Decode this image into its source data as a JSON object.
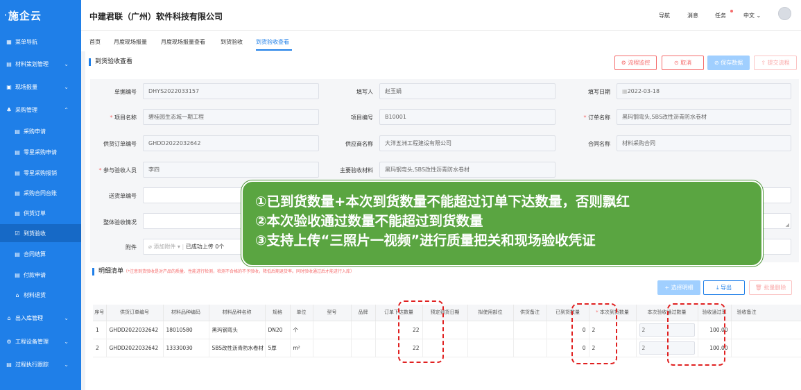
{
  "app": {
    "logo": "施企云"
  },
  "sidebar": {
    "items": [
      {
        "label": "菜单导航",
        "icon": "grid-icon"
      },
      {
        "label": "材料策划管理",
        "icon": "doc-icon"
      },
      {
        "label": "现场报量",
        "icon": "doc-icon"
      },
      {
        "label": "采购管理",
        "icon": "org-icon"
      },
      {
        "label": "采购申请",
        "icon": "doc-icon"
      },
      {
        "label": "零星采购申请",
        "icon": "doc-icon"
      },
      {
        "label": "零星采购报销",
        "icon": "doc-icon"
      },
      {
        "label": "采购合同台账",
        "icon": "doc-icon"
      },
      {
        "label": "供货订单",
        "icon": "doc-icon"
      },
      {
        "label": "到货验收",
        "icon": "check-icon"
      },
      {
        "label": "合同结算",
        "icon": "doc-icon"
      },
      {
        "label": "付款申请",
        "icon": "doc-icon"
      },
      {
        "label": "材料退货",
        "icon": "doc-icon"
      },
      {
        "label": "出入库管理",
        "icon": "home-icon"
      },
      {
        "label": "工程设备管理",
        "icon": "gear-icon"
      },
      {
        "label": "过程执行跟踪",
        "icon": "doc-icon"
      }
    ]
  },
  "header": {
    "company": "中建君联（广州）软件科技有限公司",
    "links": [
      "导航",
      "消息",
      "任务",
      "中文"
    ]
  },
  "tabs": [
    "首页",
    "月度现场报量",
    "月度现场报量查看",
    "到货验收",
    "到货验收查看"
  ],
  "page": {
    "title": "到货验收查看",
    "buttons": {
      "process": "流程监控",
      "cancel": "取消",
      "save": "保存数据",
      "submit": "提交流程"
    }
  },
  "form": {
    "doc_no_label": "单据编号",
    "doc_no": "DHYS2022033157",
    "filler_label": "填写人",
    "filler": "赵玉娟",
    "date_label": "填写日期",
    "date": "2022-03-18",
    "project_name_label": "项目名称",
    "project_name": "碧桂园生态城一期工程",
    "project_no_label": "项目编号",
    "project_no": "B10001",
    "order_name_label": "订单名称",
    "order_name": "黑玛钢弯头,SBS改性沥青防水卷材",
    "supply_order_label": "供货订单编号",
    "supply_order": "GHDD2022032642",
    "supplier_label": "供应商名称",
    "supplier": "大洋五洲工程建设有限公司",
    "contract_label": "合同名称",
    "contract": "材料采购合同",
    "inspector_label": "参与验收人员",
    "inspector": "李四",
    "material_label": "主要验收材料",
    "material": "黑玛钢弯头,SBS改性沥青防水卷材",
    "delivery_label": "送货单编号",
    "overall_label": "整体验收情况",
    "attach_label": "附件",
    "attach_btn": "添加附件",
    "attach_status": "已成功上传 0个"
  },
  "detail": {
    "title": "明细清单",
    "note": "（*注意到货验收是对产品的质量、性能进行检测，检测不合格的不予验收，降低后期退货率。同时验收通过后才能进行入库）",
    "btn_select": "选择明细",
    "btn_export": "导出",
    "btn_delete": "批量删除",
    "columns": [
      "序号",
      "供货订单编号",
      "材料品种编码",
      "材料品种名称",
      "规格",
      "单位",
      "型号",
      "品牌",
      "订单下达数量",
      "预定到货日期",
      "拟使用部位",
      "供货备注",
      "已到货数量",
      "本次到货数量",
      "本次验收通过数量",
      "验收通过率",
      "验收备注"
    ],
    "rows": [
      [
        "1",
        "GHDD2022032642",
        "18010580",
        "黑玛钢弯头",
        "DN20",
        "个",
        "",
        "",
        "22",
        "",
        "",
        "",
        "0",
        "2",
        "2",
        "100.00",
        ""
      ],
      [
        "2",
        "GHDD2022032642",
        "13330030",
        "SBS改性沥青防水卷材",
        "5厚",
        "m²",
        "",
        "",
        "22",
        "",
        "",
        "",
        "0",
        "2",
        "2",
        "100.00",
        ""
      ]
    ]
  },
  "callout": {
    "lines": [
      "①已到货数量+本次到货数量不能超过订单下达数量，否则飘红",
      "②本次验收通过数量不能超过到货数量",
      "③支持上传“三照片一视频”进行质量把关和现场验收凭证"
    ]
  },
  "colors": {
    "primary": "#1f7fe8",
    "danger": "#f56c6c",
    "callout": "#5aa541",
    "dashed": "#e02020"
  }
}
